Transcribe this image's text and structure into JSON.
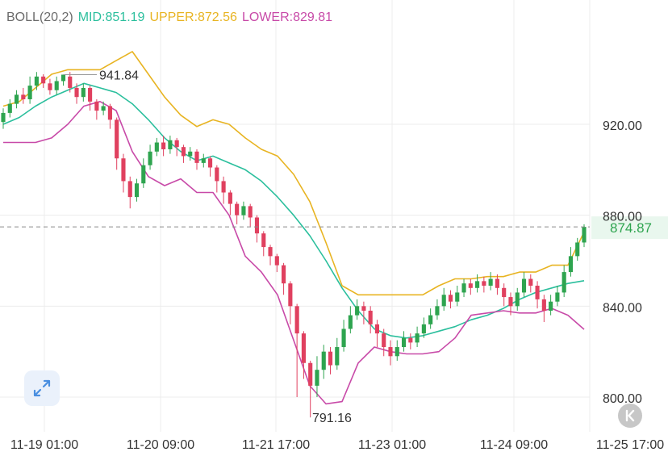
{
  "indicator": {
    "name": "BOLL(20,2)",
    "mid_label": "MID:851.19",
    "upper_label": "UPPER:872.56",
    "lower_label": "LOWER:829.81"
  },
  "colors": {
    "up": "#2ea44f",
    "down": "#e0405f",
    "mid": "#2bbf9d",
    "upper": "#e8b422",
    "lower": "#c84aa8",
    "grid": "#ececec",
    "axis_text": "#333333",
    "indicator_name": "#6b6b6b",
    "price_line": "#8a8a8a",
    "price_tag_text": "#2ea44f",
    "price_tag_bg": "#e9f7ee",
    "expand_icon": "#4a8fe0",
    "back_icon_bg": "#c7c7c7"
  },
  "icons": {
    "expand": "expand-arrows-icon",
    "back": "back-arrow-icon"
  },
  "current_price": "874.87",
  "annotations": {
    "high": "941.84",
    "low": "791.16"
  },
  "chart_data": {
    "type": "candlestick",
    "y_ticks": [
      "920.00",
      "880.00",
      "840.00",
      "800.00"
    ],
    "x_ticks": [
      "11-19 01:00",
      "11-20 09:00",
      "11-21 17:00",
      "11-23 01:00",
      "11-24 09:00",
      "11-25 17:00"
    ],
    "ylim": [
      790,
      950
    ],
    "grid": true,
    "high_value": 941.84,
    "low_value": 791.16,
    "current_value": 874.87,
    "series": [
      {
        "name": "MID",
        "values": [
          920.0,
          923.0,
          928.0,
          932.0,
          935.0,
          938.0,
          936.0,
          934.0,
          929.0,
          922.0,
          914.0,
          908.0,
          904.0,
          906.0,
          903.0,
          900.0,
          895.0,
          888.0,
          880.0,
          871.0,
          860.0,
          848.0,
          838.0,
          830.0,
          827.0,
          826.0,
          827.0,
          829.0,
          831.0,
          834.0,
          836.0,
          839.0,
          843.0,
          846.0,
          848.0,
          850.0,
          851.2
        ]
      },
      {
        "name": "UPPER",
        "values": [
          928.0,
          930.0,
          936.0,
          942.0,
          944.0,
          944.0,
          944.0,
          948.0,
          952.0,
          942.0,
          932.0,
          924.0,
          919.0,
          922.0,
          920.0,
          914.0,
          909.0,
          906.0,
          898.0,
          886.0,
          868.0,
          849.0,
          845.0,
          845.0,
          845.0,
          845.0,
          845.0,
          849.0,
          852.0,
          852.0,
          853.0,
          853.0,
          855.0,
          855.0,
          858.0,
          858.0,
          872.6
        ]
      },
      {
        "name": "LOWER",
        "values": [
          912.0,
          912.0,
          912.0,
          914.0,
          920.0,
          928.0,
          930.0,
          926.0,
          908.0,
          897.0,
          893.0,
          896.0,
          890.0,
          890.0,
          880.0,
          862.0,
          855.0,
          845.0,
          825.0,
          805.0,
          797.0,
          798.0,
          815.0,
          822.0,
          820.0,
          819.0,
          819.0,
          820.0,
          826.0,
          836.0,
          837.0,
          838.0,
          837.0,
          837.0,
          839.0,
          836.0,
          829.8
        ]
      },
      {
        "name": "candles",
        "values": [
          [
            921,
            925,
            918,
            927
          ],
          [
            925,
            929,
            923,
            931
          ],
          [
            929,
            933,
            927,
            935
          ],
          [
            933,
            931,
            929,
            936
          ],
          [
            931,
            937,
            929,
            941
          ],
          [
            937,
            941,
            935,
            943
          ],
          [
            941,
            938,
            936,
            942
          ],
          [
            938,
            935,
            933,
            940
          ],
          [
            935,
            939,
            933,
            941
          ],
          [
            939,
            941.84,
            937,
            941.84
          ],
          [
            941,
            936,
            934,
            943
          ],
          [
            936,
            932,
            929,
            938
          ],
          [
            932,
            936,
            930,
            938
          ],
          [
            936,
            930,
            926,
            937
          ],
          [
            930,
            926,
            922,
            931
          ],
          [
            926,
            928,
            924,
            930
          ],
          [
            928,
            922,
            918,
            929
          ],
          [
            922,
            905,
            900,
            923
          ],
          [
            905,
            895,
            890,
            907
          ],
          [
            895,
            888,
            883,
            897
          ],
          [
            888,
            894,
            886,
            896
          ],
          [
            894,
            902,
            892,
            905
          ],
          [
            902,
            908,
            900,
            911
          ],
          [
            908,
            912,
            906,
            914
          ],
          [
            912,
            909,
            906,
            915
          ],
          [
            909,
            913,
            907,
            915
          ],
          [
            913,
            910,
            906,
            914
          ],
          [
            910,
            906,
            903,
            911
          ],
          [
            906,
            908,
            904,
            910
          ],
          [
            908,
            903,
            900,
            909
          ],
          [
            903,
            905,
            901,
            907
          ],
          [
            905,
            901,
            897,
            906
          ],
          [
            901,
            895,
            890,
            902
          ],
          [
            895,
            890,
            885,
            897
          ],
          [
            890,
            885,
            880,
            891
          ],
          [
            885,
            880,
            876,
            886
          ],
          [
            880,
            884,
            878,
            886
          ],
          [
            884,
            879,
            875,
            885
          ],
          [
            879,
            872,
            868,
            880
          ],
          [
            872,
            866,
            862,
            873
          ],
          [
            866,
            862,
            858,
            867
          ],
          [
            862,
            858,
            855,
            863
          ],
          [
            858,
            850,
            845,
            859
          ],
          [
            850,
            840,
            832,
            851
          ],
          [
            840,
            828,
            800,
            841
          ],
          [
            828,
            815,
            808,
            829
          ],
          [
            815,
            805,
            791.16,
            816
          ],
          [
            805,
            812,
            800,
            818
          ],
          [
            812,
            820,
            808,
            823
          ],
          [
            820,
            814,
            810,
            822
          ],
          [
            814,
            822,
            812,
            826
          ],
          [
            822,
            830,
            820,
            834
          ],
          [
            830,
            836,
            828,
            840
          ],
          [
            836,
            840,
            834,
            843
          ],
          [
            840,
            838,
            832,
            842
          ],
          [
            838,
            832,
            828,
            840
          ],
          [
            832,
            828,
            822,
            834
          ],
          [
            828,
            822,
            818,
            830
          ],
          [
            822,
            818,
            814,
            825
          ],
          [
            818,
            822,
            816,
            825
          ],
          [
            822,
            826,
            820,
            829
          ],
          [
            826,
            824,
            821,
            828
          ],
          [
            824,
            828,
            822,
            831
          ],
          [
            828,
            832,
            826,
            835
          ],
          [
            832,
            836,
            830,
            839
          ],
          [
            836,
            840,
            834,
            843
          ],
          [
            840,
            845,
            838,
            848
          ],
          [
            845,
            842,
            839,
            847
          ],
          [
            842,
            846,
            840,
            849
          ],
          [
            846,
            850,
            844,
            852
          ],
          [
            850,
            848,
            845,
            852
          ],
          [
            848,
            851,
            846,
            854
          ],
          [
            851,
            849,
            846,
            853
          ],
          [
            849,
            852,
            847,
            855
          ],
          [
            852,
            848,
            845,
            854
          ],
          [
            848,
            844,
            840,
            850
          ],
          [
            844,
            840,
            836,
            846
          ],
          [
            840,
            846,
            838,
            848
          ],
          [
            846,
            852,
            844,
            855
          ],
          [
            852,
            849,
            846,
            854
          ],
          [
            849,
            843,
            839,
            851
          ],
          [
            843,
            838,
            833,
            845
          ],
          [
            838,
            842,
            836,
            845
          ],
          [
            842,
            846,
            840,
            849
          ],
          [
            846,
            855,
            844,
            858
          ],
          [
            855,
            862,
            853,
            866
          ],
          [
            862,
            868,
            860,
            870
          ],
          [
            868,
            874.87,
            866,
            876
          ]
        ]
      }
    ]
  }
}
